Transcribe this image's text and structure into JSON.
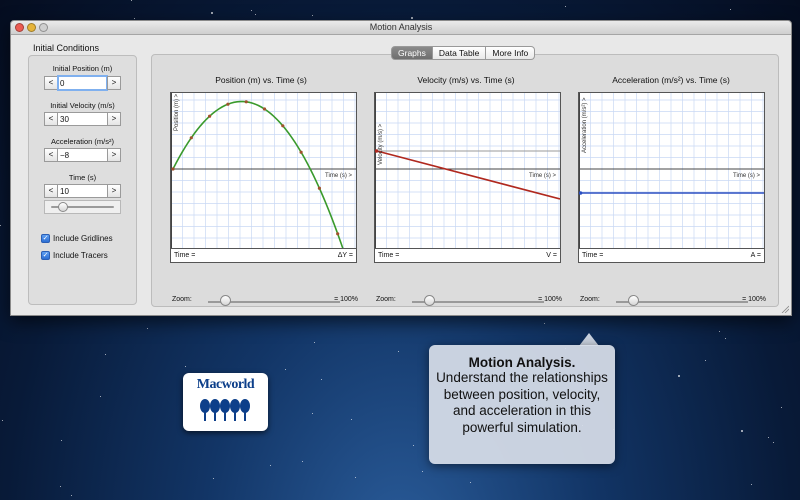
{
  "window": {
    "title": "Motion Analysis"
  },
  "initial_conditions": {
    "title": "Initial Conditions",
    "fields": [
      {
        "label": "Initial Position (m)",
        "value": "0"
      },
      {
        "label": "Initial Velocity (m/s)",
        "value": "30"
      },
      {
        "label": "Acceleration (m/s²)",
        "value": "−8"
      },
      {
        "label": "Time (s)",
        "value": "10"
      }
    ],
    "decrement_label": "<",
    "increment_label": ">",
    "time_slider_level": 0.12,
    "checkboxes": [
      {
        "label": "Include Gridlines",
        "checked": true
      },
      {
        "label": "Include Tracers",
        "checked": true
      }
    ]
  },
  "tabs": [
    {
      "label": "Graphs",
      "active": true
    },
    {
      "label": "Data Table",
      "active": false
    },
    {
      "label": "More Info",
      "active": false
    }
  ],
  "graphs": [
    {
      "title": "Position (m) vs. Time (s)",
      "y_axis_label": "Position (m) >",
      "x_axis_label": "Time (s) >",
      "readout_left": "Time =",
      "readout_right": "ΔY =",
      "zoom_label": "Zoom:",
      "zoom_value": "= 100%",
      "zoom_level": 0.1,
      "line_color": "#3a9a2c",
      "tracer_color": "#a0522d"
    },
    {
      "title": "Velocity (m/s) vs. Time (s)",
      "y_axis_label": "Velocity (m/s) >",
      "x_axis_label": "Time (s) >",
      "readout_left": "Time =",
      "readout_right": "V =",
      "zoom_label": "Zoom:",
      "zoom_value": "= 100%",
      "zoom_level": 0.1,
      "line_color": "#b0281e"
    },
    {
      "title": "Acceleration (m/s²) vs. Time (s)",
      "y_axis_label": "Acceleration (m/s²) >",
      "x_axis_label": "Time (s) >",
      "readout_left": "Time =",
      "readout_right": "A =",
      "zoom_label": "Zoom:",
      "zoom_value": "= 100%",
      "zoom_level": 0.1,
      "line_color": "#2b4fc2"
    }
  ],
  "badge": {
    "text": "Macworld"
  },
  "callout": {
    "title": "Motion Analysis.",
    "body": "Understand the relationships between position, velocity, and acceleration in this powerful simulation."
  }
}
